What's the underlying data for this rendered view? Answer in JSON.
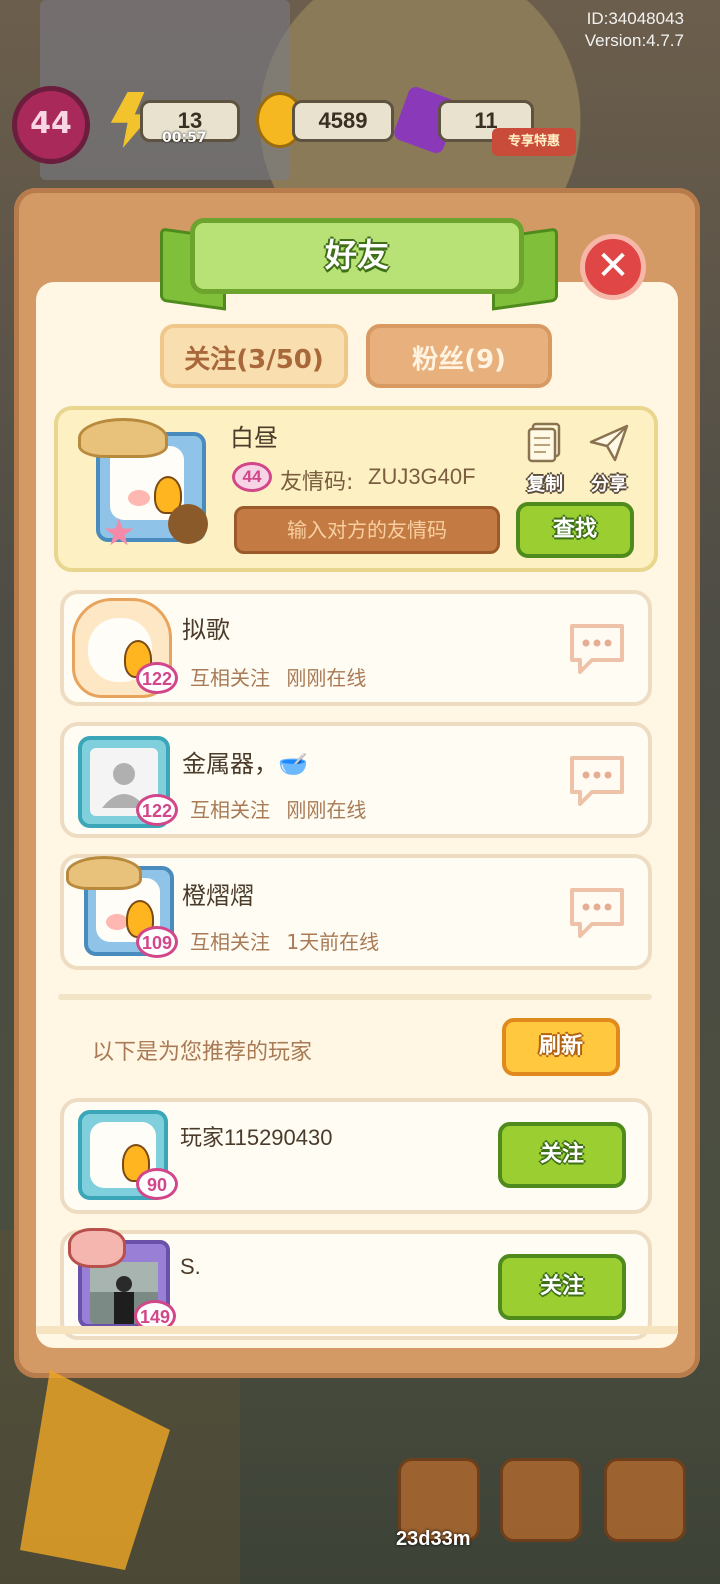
{
  "header": {
    "id": "ID:34048043",
    "version": "Version:4.7.7"
  },
  "hud": {
    "level": "44",
    "energy": "13",
    "energy_timer": "00:57",
    "coins": "4589",
    "gems": "11",
    "promo_label": "专享特惠"
  },
  "dialog": {
    "title": "好友",
    "close_icon": "close-icon"
  },
  "tabs": {
    "follow": "关注(3/50)",
    "fans": "粉丝(9)"
  },
  "me": {
    "name": "白昼",
    "level": "44",
    "code_label": "友情码:",
    "code_value": "ZUJ3G40F",
    "code_placeholder": "输入对方的友情码",
    "copy_label": "复制",
    "share_label": "分享",
    "find_label": "查找"
  },
  "friends": [
    {
      "name": "拟歌",
      "level": "122",
      "relation": "互相关注",
      "online": "刚刚在线"
    },
    {
      "name": "金属器，🥣",
      "level": "122",
      "relation": "互相关注",
      "online": "刚刚在线"
    },
    {
      "name": "橙熠熠",
      "level": "109",
      "relation": "互相关注",
      "online": "1天前在线"
    }
  ],
  "recommend": {
    "title": "以下是为您推荐的玩家",
    "refresh_label": "刷新",
    "players": [
      {
        "name": "玩家115290430",
        "level": "90",
        "follow_label": "关注"
      },
      {
        "name": "S.",
        "level": "149",
        "follow_label": "关注"
      }
    ]
  },
  "bottom": {
    "timer": "23d33m"
  },
  "colors": {
    "panel": "#d49a66",
    "inner": "#fff7e4",
    "green": "#9bcf31",
    "orange": "#ffc83e",
    "heart": "#d2468a"
  }
}
